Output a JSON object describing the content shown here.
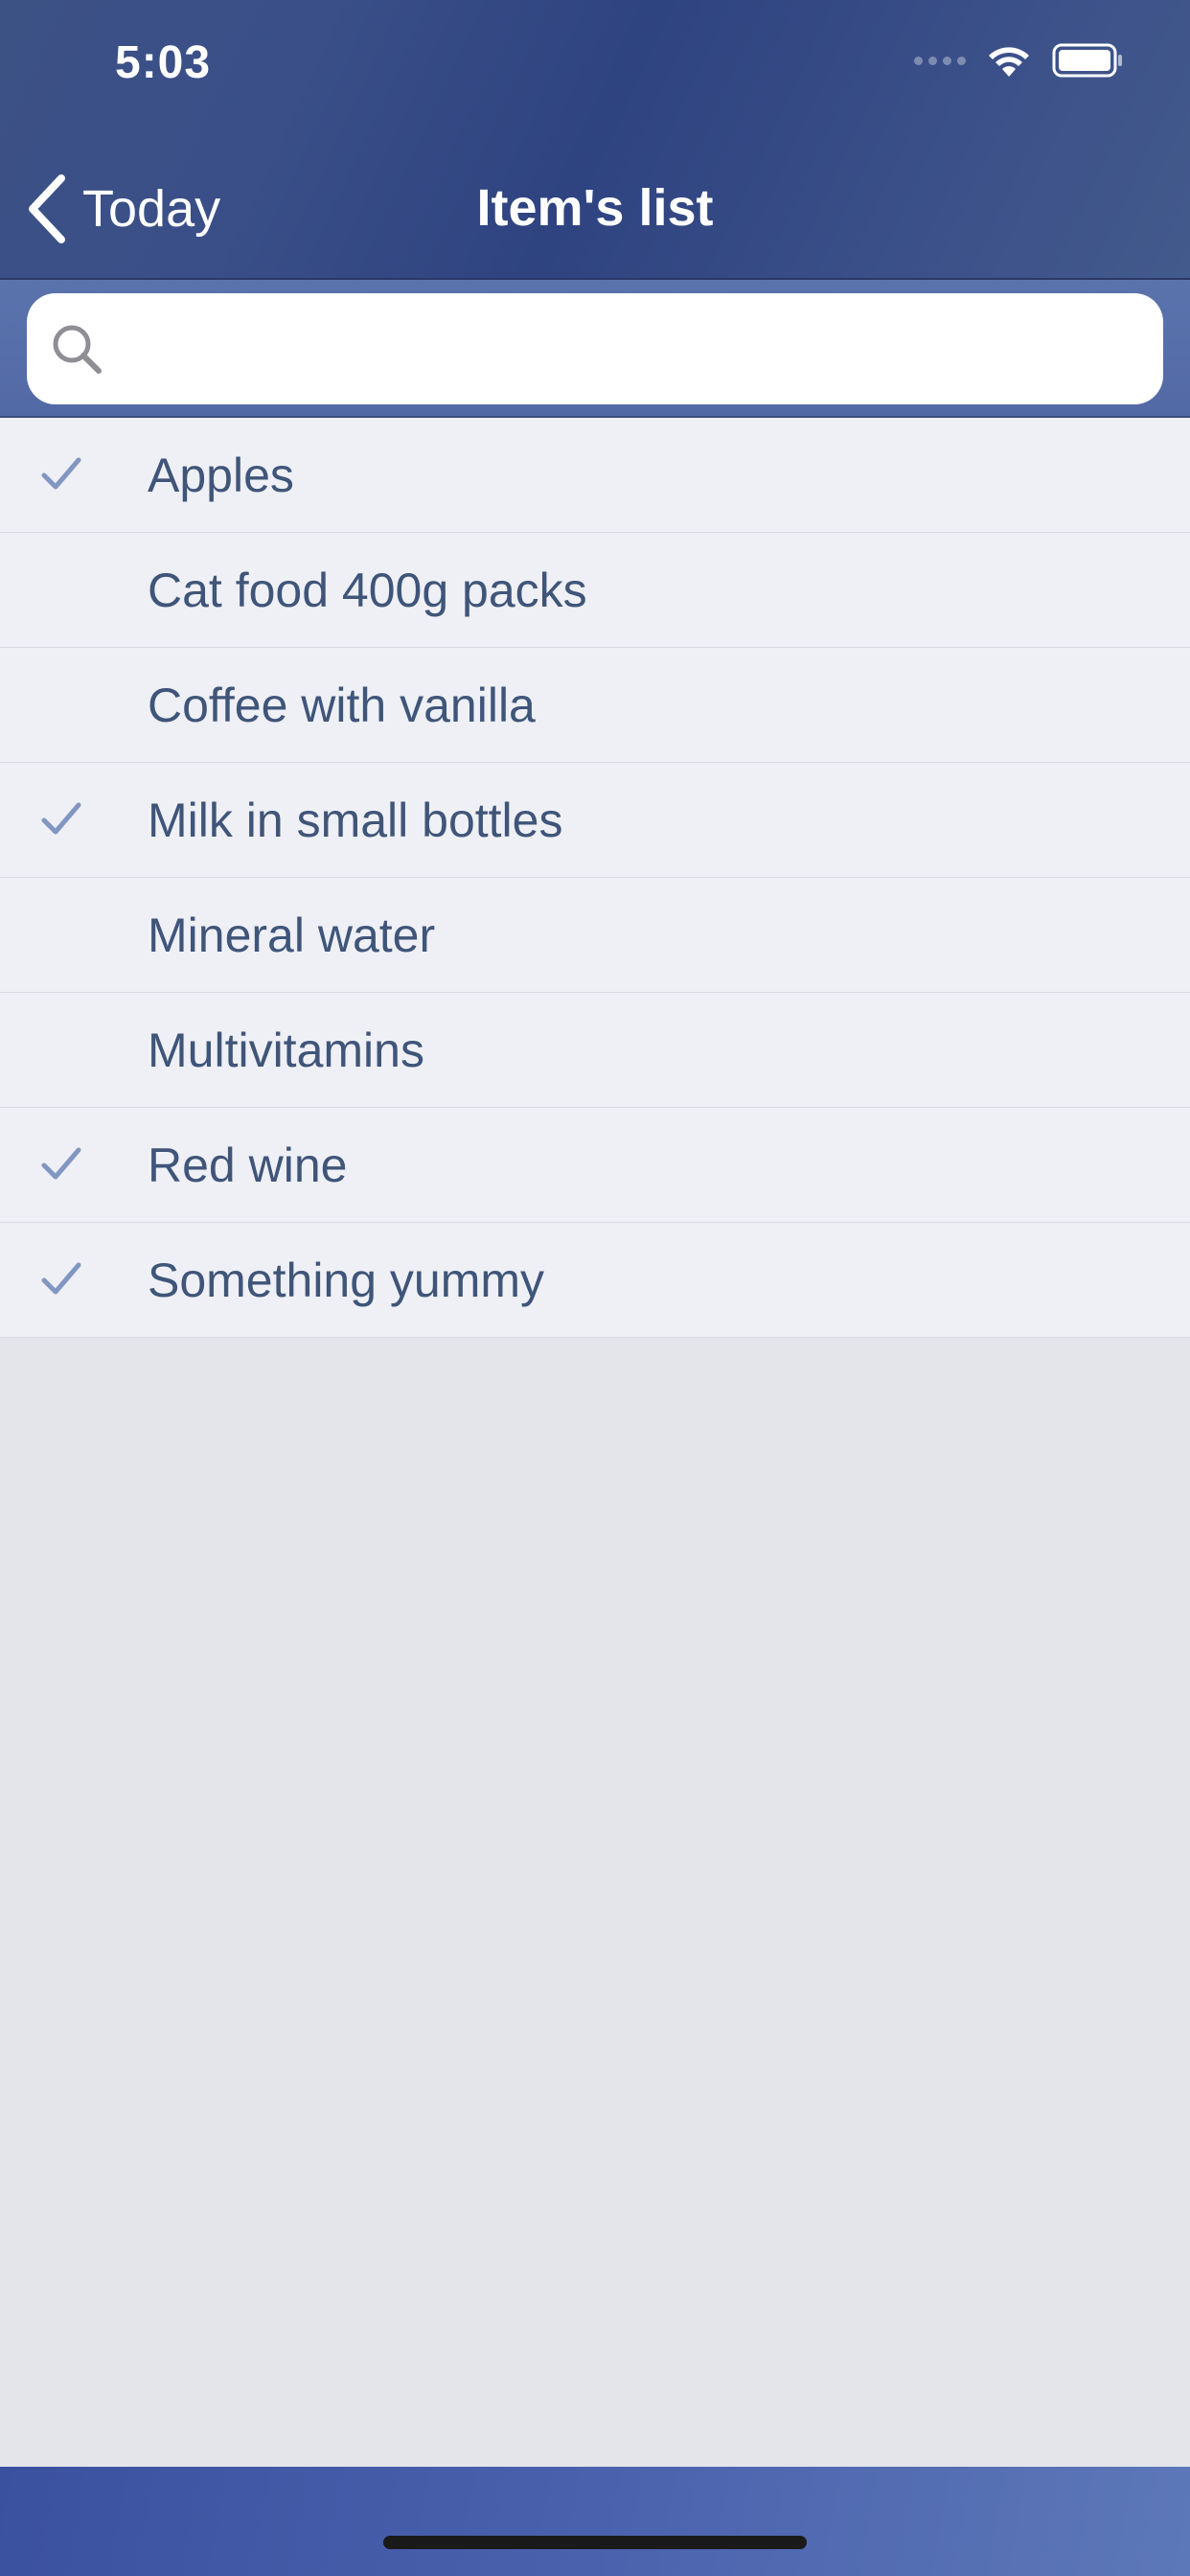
{
  "status_bar": {
    "time": "5:03"
  },
  "nav": {
    "back_label": "Today",
    "title": "Item's list"
  },
  "search": {
    "value": "",
    "placeholder": ""
  },
  "items": [
    {
      "label": "Apples",
      "checked": true
    },
    {
      "label": "Cat food 400g packs",
      "checked": false
    },
    {
      "label": "Coffee with vanilla",
      "checked": false
    },
    {
      "label": "Milk in small bottles",
      "checked": true
    },
    {
      "label": "Mineral water",
      "checked": false
    },
    {
      "label": "Multivitamins",
      "checked": false
    },
    {
      "label": "Red wine",
      "checked": true
    },
    {
      "label": "Something yummy",
      "checked": true
    }
  ],
  "icons": {
    "back": "chevron-left-icon",
    "search": "search-icon",
    "check": "checkmark-icon",
    "wifi": "wifi-icon",
    "battery": "battery-icon"
  },
  "colors": {
    "header": "#3a4f88",
    "search_bar": "#5b73ad",
    "list_bg": "#eff0f5",
    "item_text": "#3f5579",
    "check": "#8296c2",
    "page_bg": "#e4e5eb"
  }
}
